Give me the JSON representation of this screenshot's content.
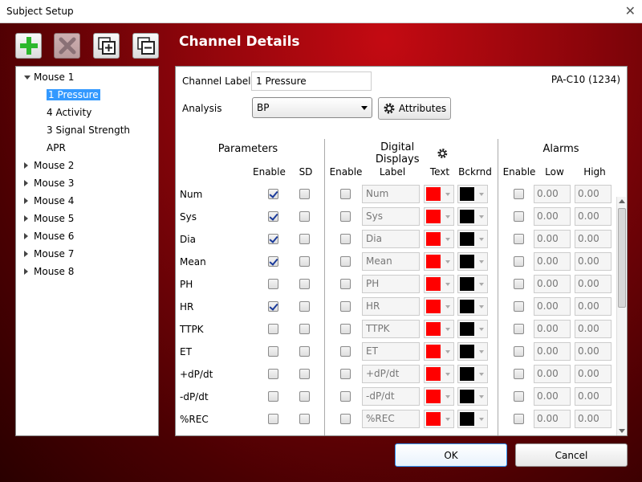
{
  "window": {
    "title": "Subject Setup",
    "close_glyph": "✕"
  },
  "toolbar": {
    "icons": [
      "plus-icon",
      "delete-icon",
      "add-copy-icon",
      "remove-copy-icon"
    ]
  },
  "page": {
    "heading": "Channel Details"
  },
  "tree": {
    "nodes": [
      {
        "label": "Mouse 1",
        "level": 0,
        "expanded": true
      },
      {
        "label": "1  Pressure",
        "level": 1,
        "selected": true
      },
      {
        "label": "4  Activity",
        "level": 1
      },
      {
        "label": "3  Signal Strength",
        "level": 1
      },
      {
        "label": "APR",
        "level": 1
      },
      {
        "label": "Mouse 2",
        "level": 0
      },
      {
        "label": "Mouse 3",
        "level": 0
      },
      {
        "label": "Mouse 4",
        "level": 0
      },
      {
        "label": "Mouse 5",
        "level": 0
      },
      {
        "label": "Mouse 6",
        "level": 0
      },
      {
        "label": "Mouse 7",
        "level": 0
      },
      {
        "label": "Mouse 8",
        "level": 0
      }
    ]
  },
  "channel": {
    "label_caption": "Channel Label",
    "label_value": "1  Pressure",
    "device_id": "PA-C10 (1234)",
    "analysis_caption": "Analysis",
    "analysis_value": "BP",
    "attributes_label": "Attributes"
  },
  "sections": {
    "parameters": "Parameters",
    "digital_displays": "Digital Displays",
    "alarms": "Alarms"
  },
  "columns": {
    "enable": "Enable",
    "sd": "SD",
    "dd_enable": "Enable",
    "label": "Label",
    "text": "Text",
    "bckrnd": "Bckrnd",
    "alarm_enable": "Enable",
    "low": "Low",
    "high": "High"
  },
  "colors": {
    "text_color": "#ff0000",
    "background_color": "#000000",
    "selection": "#3399ff"
  },
  "rows": [
    {
      "name": "Num",
      "enable": true,
      "sd": false,
      "label": "Num",
      "low": "0.00",
      "high": "0.00"
    },
    {
      "name": "Sys",
      "enable": true,
      "sd": false,
      "label": "Sys",
      "low": "0.00",
      "high": "0.00"
    },
    {
      "name": "Dia",
      "enable": true,
      "sd": false,
      "label": "Dia",
      "low": "0.00",
      "high": "0.00"
    },
    {
      "name": "Mean",
      "enable": true,
      "sd": false,
      "label": "Mean",
      "low": "0.00",
      "high": "0.00"
    },
    {
      "name": "PH",
      "enable": false,
      "sd": false,
      "label": "PH",
      "low": "0.00",
      "high": "0.00"
    },
    {
      "name": "HR",
      "enable": true,
      "sd": false,
      "label": "HR",
      "low": "0.00",
      "high": "0.00"
    },
    {
      "name": "TTPK",
      "enable": false,
      "sd": false,
      "label": "TTPK",
      "low": "0.00",
      "high": "0.00"
    },
    {
      "name": "ET",
      "enable": false,
      "sd": false,
      "label": "ET",
      "low": "0.00",
      "high": "0.00"
    },
    {
      "name": "+dP/dt",
      "enable": false,
      "sd": false,
      "label": "+dP/dt",
      "low": "0.00",
      "high": "0.00"
    },
    {
      "name": "-dP/dt",
      "enable": false,
      "sd": false,
      "label": "-dP/dt",
      "low": "0.00",
      "high": "0.00"
    },
    {
      "name": "%REC",
      "enable": false,
      "sd": false,
      "label": "%REC",
      "low": "0.00",
      "high": "0.00"
    }
  ],
  "footer": {
    "ok": "OK",
    "cancel": "Cancel"
  }
}
